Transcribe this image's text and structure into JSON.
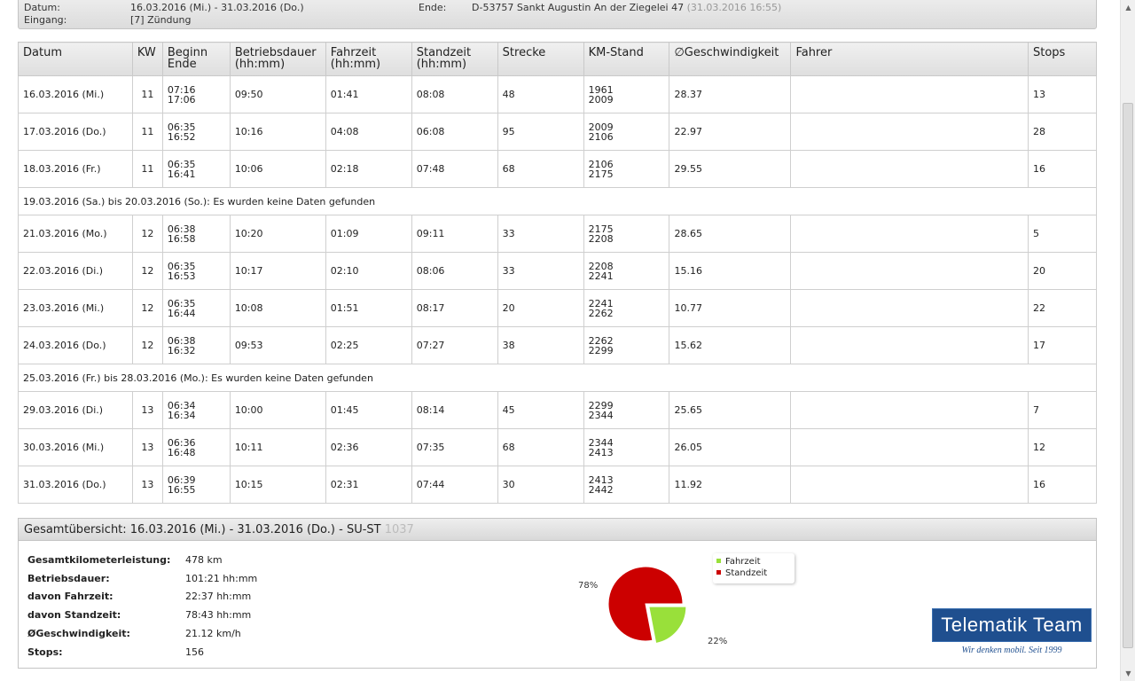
{
  "header": {
    "datum_label": "Datum:",
    "datum_value": "16.03.2016 (Mi.) - 31.03.2016 (Do.)",
    "eingang_label": "Eingang:",
    "eingang_value": "[7] Zündung",
    "ende_label": "Ende:",
    "ende_value": "D-53757 Sankt Augustin An der Ziegelei 47",
    "ende_time": "(31.03.2016 16:55)"
  },
  "table": {
    "columns": [
      "Datum",
      "KW",
      "Beginn\nEnde",
      "Betriebsdauer\n(hh:mm)",
      "Fahrzeit\n(hh:mm)",
      "Standzeit\n(hh:mm)",
      "Strecke",
      "KM-Stand",
      "∅Geschwindigkeit",
      "Fahrer",
      "Stops"
    ],
    "rows": [
      {
        "datum": "16.03.2016 (Mi.)",
        "kw": "11",
        "beginn": "07:16",
        "ende": "17:06",
        "betrieb": "09:50",
        "fahrzeit": "01:41",
        "standzeit": "08:08",
        "strecke": "48",
        "km_start": "1961",
        "km_end": "2009",
        "speed": "28.37",
        "fahrer": "",
        "stops": "13"
      },
      {
        "datum": "17.03.2016 (Do.)",
        "kw": "11",
        "beginn": "06:35",
        "ende": "16:52",
        "betrieb": "10:16",
        "fahrzeit": "04:08",
        "standzeit": "06:08",
        "strecke": "95",
        "km_start": "2009",
        "km_end": "2106",
        "speed": "22.97",
        "fahrer": "",
        "stops": "28"
      },
      {
        "datum": "18.03.2016 (Fr.)",
        "kw": "11",
        "beginn": "06:35",
        "ende": "16:41",
        "betrieb": "10:06",
        "fahrzeit": "02:18",
        "standzeit": "07:48",
        "strecke": "68",
        "km_start": "2106",
        "km_end": "2175",
        "speed": "29.55",
        "fahrer": "",
        "stops": "16"
      },
      {
        "gap": "19.03.2016 (Sa.) bis 20.03.2016 (So.): Es wurden keine Daten gefunden"
      },
      {
        "datum": "21.03.2016 (Mo.)",
        "kw": "12",
        "beginn": "06:38",
        "ende": "16:58",
        "betrieb": "10:20",
        "fahrzeit": "01:09",
        "standzeit": "09:11",
        "strecke": "33",
        "km_start": "2175",
        "km_end": "2208",
        "speed": "28.65",
        "fahrer": "",
        "stops": "5"
      },
      {
        "datum": "22.03.2016 (Di.)",
        "kw": "12",
        "beginn": "06:35",
        "ende": "16:53",
        "betrieb": "10:17",
        "fahrzeit": "02:10",
        "standzeit": "08:06",
        "strecke": "33",
        "km_start": "2208",
        "km_end": "2241",
        "speed": "15.16",
        "fahrer": "",
        "stops": "20"
      },
      {
        "datum": "23.03.2016 (Mi.)",
        "kw": "12",
        "beginn": "06:35",
        "ende": "16:44",
        "betrieb": "10:08",
        "fahrzeit": "01:51",
        "standzeit": "08:17",
        "strecke": "20",
        "km_start": "2241",
        "km_end": "2262",
        "speed": "10.77",
        "fahrer": "",
        "stops": "22"
      },
      {
        "datum": "24.03.2016 (Do.)",
        "kw": "12",
        "beginn": "06:38",
        "ende": "16:32",
        "betrieb": "09:53",
        "fahrzeit": "02:25",
        "standzeit": "07:27",
        "strecke": "38",
        "km_start": "2262",
        "km_end": "2299",
        "speed": "15.62",
        "fahrer": "",
        "stops": "17"
      },
      {
        "gap": "25.03.2016 (Fr.) bis 28.03.2016 (Mo.): Es wurden keine Daten gefunden"
      },
      {
        "datum": "29.03.2016 (Di.)",
        "kw": "13",
        "beginn": "06:34",
        "ende": "16:34",
        "betrieb": "10:00",
        "fahrzeit": "01:45",
        "standzeit": "08:14",
        "strecke": "45",
        "km_start": "2299",
        "km_end": "2344",
        "speed": "25.65",
        "fahrer": "",
        "stops": "7"
      },
      {
        "datum": "30.03.2016 (Mi.)",
        "kw": "13",
        "beginn": "06:36",
        "ende": "16:48",
        "betrieb": "10:11",
        "fahrzeit": "02:36",
        "standzeit": "07:35",
        "strecke": "68",
        "km_start": "2344",
        "km_end": "2413",
        "speed": "26.05",
        "fahrer": "",
        "stops": "12"
      },
      {
        "datum": "31.03.2016 (Do.)",
        "kw": "13",
        "beginn": "06:39",
        "ende": "16:55",
        "betrieb": "10:15",
        "fahrzeit": "02:31",
        "standzeit": "07:44",
        "strecke": "30",
        "km_start": "2413",
        "km_end": "2442",
        "speed": "11.92",
        "fahrer": "",
        "stops": "16"
      }
    ]
  },
  "summary": {
    "title": "Gesamtübersicht: 16.03.2016 (Mi.) - 31.03.2016 (Do.) - SU-ST",
    "title_hidden": "1037",
    "stats": [
      {
        "label": "Gesamtkilometerleistung:",
        "value": "478 km"
      },
      {
        "label": "Betriebsdauer:",
        "value": "101:21 hh:mm"
      },
      {
        "label": "davon Fahrzeit:",
        "value": "22:37 hh:mm"
      },
      {
        "label": "davon Standzeit:",
        "value": "78:43 hh:mm"
      },
      {
        "label": "ØGeschwindigkeit:",
        "value": "21.12 km/h"
      },
      {
        "label": "Stops:",
        "value": "156"
      }
    ]
  },
  "chart_data": {
    "type": "pie",
    "categories": [
      "Fahrzeit",
      "Standzeit"
    ],
    "values": [
      22,
      78
    ],
    "labels": [
      "22%",
      "78%"
    ],
    "colors": [
      "#99e03a",
      "#cc0000"
    ],
    "legend": "top-right"
  },
  "logo": {
    "name": "Telematik Team",
    "tagline": "Wir denken mobil. Seit 1999"
  },
  "scrollbar": {
    "up_icon": "▲",
    "down_icon": "▼"
  }
}
